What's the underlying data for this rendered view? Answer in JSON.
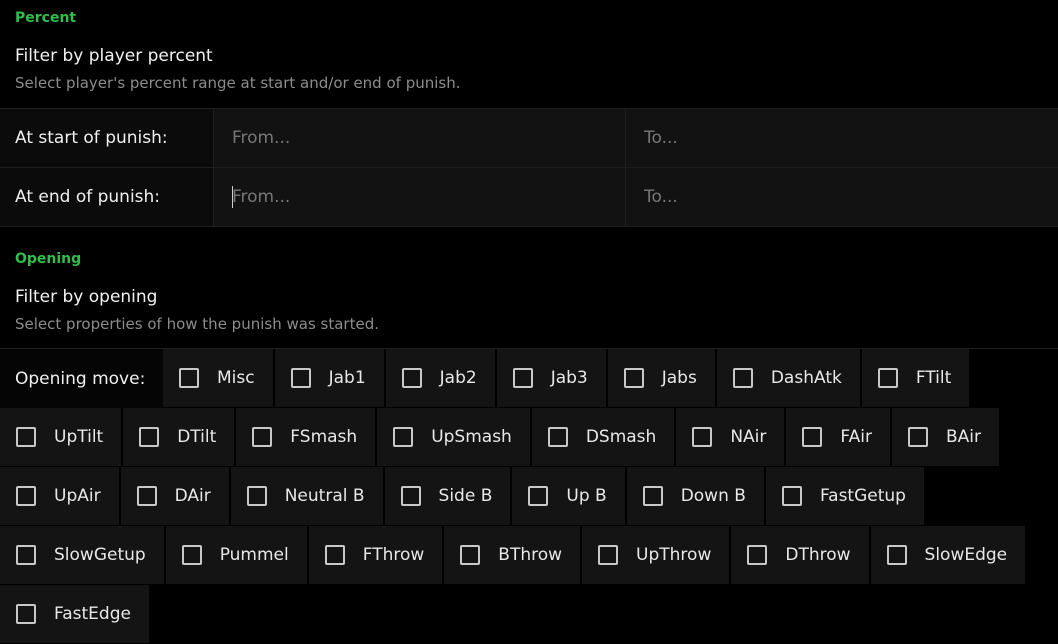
{
  "percent": {
    "section_title": "Percent",
    "heading": "Filter by player percent",
    "description": "Select player's percent range at start and/or end of punish.",
    "rows": [
      {
        "label": "At start of punish:",
        "from_placeholder": "From...",
        "to_placeholder": "To..."
      },
      {
        "label": "At end of punish:",
        "from_placeholder": "From...",
        "to_placeholder": "To..."
      }
    ]
  },
  "opening": {
    "section_title": "Opening",
    "heading": "Filter by opening",
    "description": "Select properties of how the punish was started.",
    "row_label": "Opening move:",
    "rows": [
      [
        "Misc",
        "Jab1",
        "Jab2",
        "Jab3",
        "Jabs",
        "DashAtk",
        "FTilt"
      ],
      [
        "UpTilt",
        "DTilt",
        "FSmash",
        "UpSmash",
        "DSmash",
        "NAir",
        "FAir",
        "BAir"
      ],
      [
        "UpAir",
        "DAir",
        "Neutral B",
        "Side B",
        "Up B",
        "Down B",
        "FastGetup"
      ],
      [
        "SlowGetup",
        "Pummel",
        "FThrow",
        "BThrow",
        "UpThrow",
        "DThrow",
        "SlowEdge"
      ],
      [
        "FastEdge"
      ]
    ]
  }
}
